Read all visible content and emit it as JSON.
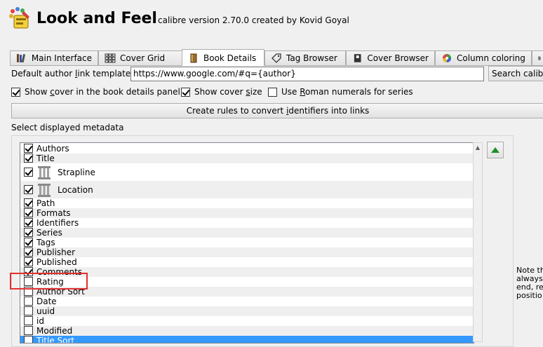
{
  "header": {
    "title": "Look and Feel",
    "subtitle": "calibre version 2.70.0 created by Kovid Goyal"
  },
  "tabs": [
    {
      "label": "Main Interface",
      "icon": "books-icon"
    },
    {
      "label": "Cover Grid",
      "icon": "grid-icon"
    },
    {
      "label": "Book Details",
      "icon": "book-icon",
      "active": true
    },
    {
      "label": "Tag Browser",
      "icon": "tag-icon"
    },
    {
      "label": "Cover Browser",
      "icon": "cover-browser-icon"
    },
    {
      "label": "Column coloring",
      "icon": "color-wheel-icon"
    }
  ],
  "book_details": {
    "author_link_label": "Default author link template:",
    "author_link_value": "https://www.google.com/#q={author}",
    "search_button": "Search calibr",
    "show_cover_label": "Show cover in the book details panel",
    "show_cover_checked": true,
    "show_cover_size_label": "Show cover size",
    "show_cover_size_checked": true,
    "roman_label": "Use Roman numerals for series",
    "roman_checked": false,
    "rules_button": "Create rules to convert identifiers into links",
    "metadata_label": "Select displayed metadata",
    "note_lines": [
      "Note th",
      "always",
      "end, re",
      "positio"
    ]
  },
  "metadata": [
    {
      "label": "Authors",
      "checked": true
    },
    {
      "label": "Title",
      "checked": true
    },
    {
      "label": "Strapline",
      "checked": true,
      "icon": "column-icon"
    },
    {
      "label": "Location",
      "checked": true,
      "icon": "column-icon"
    },
    {
      "label": "Path",
      "checked": true
    },
    {
      "label": "Formats",
      "checked": true
    },
    {
      "label": "Identifiers",
      "checked": true
    },
    {
      "label": "Series",
      "checked": true
    },
    {
      "label": "Tags",
      "checked": true
    },
    {
      "label": "Publisher",
      "checked": true
    },
    {
      "label": "Published",
      "checked": true
    },
    {
      "label": "Comments",
      "checked": true
    },
    {
      "label": "Rating",
      "checked": false
    },
    {
      "label": "Author Sort",
      "checked": false
    },
    {
      "label": "Date",
      "checked": false
    },
    {
      "label": "uuid",
      "checked": false
    },
    {
      "label": "id",
      "checked": false
    },
    {
      "label": "Modified",
      "checked": false
    },
    {
      "label": "Title Sort",
      "checked": false,
      "selected": true
    }
  ],
  "colors": {
    "selection": "#3399ff",
    "highlight_box": "#e23030",
    "move_up_arrow": "#1f8f2f"
  }
}
